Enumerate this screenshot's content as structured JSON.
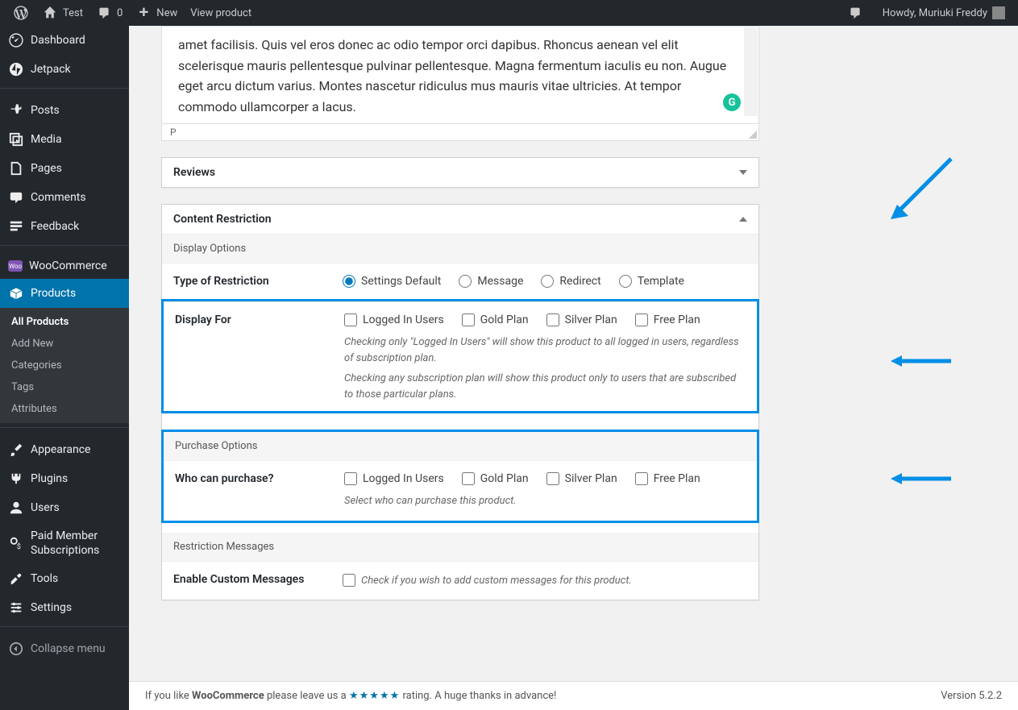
{
  "adminbar": {
    "site_name": "Test",
    "comments_count": "0",
    "new_label": "New",
    "view_product": "View product",
    "howdy": "Howdy, Muriuki Freddy"
  },
  "sidebar": {
    "dashboard": "Dashboard",
    "jetpack": "Jetpack",
    "posts": "Posts",
    "media": "Media",
    "pages": "Pages",
    "comments": "Comments",
    "feedback": "Feedback",
    "woocommerce": "WooCommerce",
    "products": "Products",
    "products_sub": {
      "all": "All Products",
      "add": "Add New",
      "categories": "Categories",
      "tags": "Tags",
      "attributes": "Attributes"
    },
    "appearance": "Appearance",
    "plugins": "Plugins",
    "users": "Users",
    "pms": "Paid Member Subscriptions",
    "tools": "Tools",
    "settings": "Settings",
    "collapse": "Collapse menu"
  },
  "editor": {
    "text": "amet facilisis. Quis vel eros donec ac odio tempor orci dapibus. Rhoncus aenean vel elit scelerisque mauris pellentesque pulvinar pellentesque. Magna fermentum iaculis eu non. Augue eget arcu dictum varius. Montes nascetur ridiculus mus mauris vitae ultricies. At tempor commodo ullamcorper a lacus.",
    "path": "P"
  },
  "boxes": {
    "reviews_title": "Reviews",
    "cr_title": "Content Restriction",
    "display_options": "Display Options",
    "type_label": "Type of Restriction",
    "type_opts": {
      "default": "Settings Default",
      "message": "Message",
      "redirect": "Redirect",
      "template": "Template"
    },
    "display_for_label": "Display For",
    "plan_opts": {
      "logged": "Logged In Users",
      "gold": "Gold Plan",
      "silver": "Silver Plan",
      "free": "Free Plan"
    },
    "display_for_help1": "Checking only \"Logged In Users\" will show this product to all logged in users, regardless of subscription plan.",
    "display_for_help2": "Checking any subscription plan will show this product only to users that are subscribed to those particular plans.",
    "purchase_options": "Purchase Options",
    "who_can_purchase_label": "Who can purchase?",
    "who_can_purchase_help": "Select who can purchase this product.",
    "restriction_messages": "Restriction Messages",
    "enable_custom_label": "Enable Custom Messages",
    "enable_custom_help": "Check if you wish to add custom messages for this product."
  },
  "footer": {
    "pre": "If you like ",
    "woo": "WooCommerce",
    "post1": " please leave us a ",
    "stars": "★★★★★",
    "post2": " rating. A huge thanks in advance!",
    "version": "Version 5.2.2"
  }
}
